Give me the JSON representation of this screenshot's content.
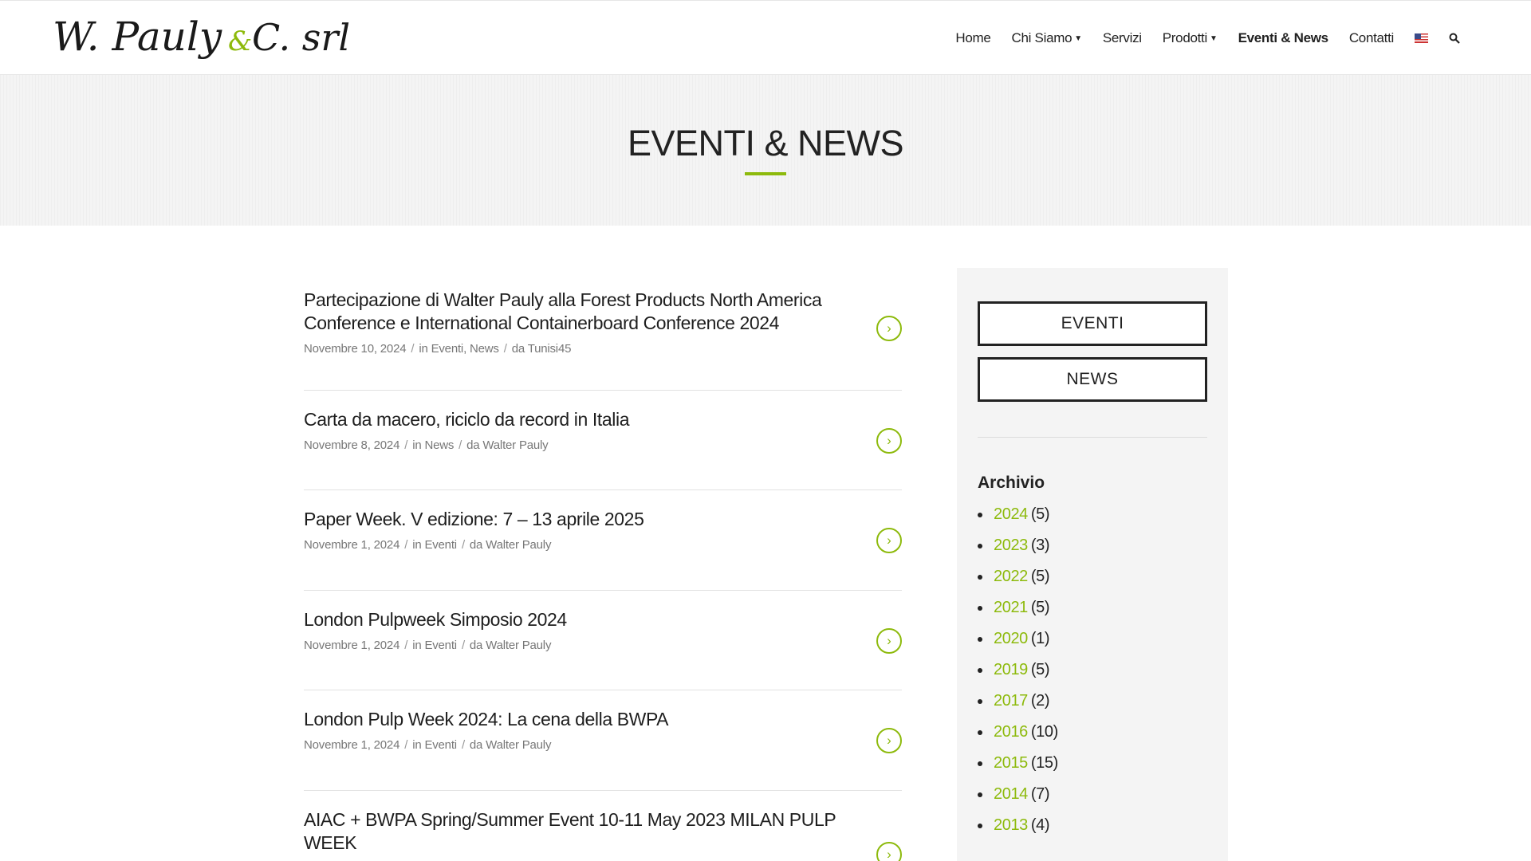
{
  "logo": {
    "text_main": "W. Pauly",
    "text_amp": "&",
    "text_tail": "C. srl"
  },
  "nav": {
    "items": [
      {
        "label": "Home",
        "dropdown": false,
        "active": false
      },
      {
        "label": "Chi Siamo",
        "dropdown": true,
        "active": false
      },
      {
        "label": "Servizi",
        "dropdown": false,
        "active": false
      },
      {
        "label": "Prodotti",
        "dropdown": true,
        "active": false
      },
      {
        "label": "Eventi & News",
        "dropdown": false,
        "active": true
      },
      {
        "label": "Contatti",
        "dropdown": false,
        "active": false
      }
    ],
    "flag_icon": "us-flag-icon",
    "search_icon": "search-icon"
  },
  "banner": {
    "title": "EVENTI & NEWS"
  },
  "posts": [
    {
      "title": "Partecipazione di Walter Pauly alla Forest Products North America Conference e International Containerboard Conference 2024",
      "date": "Novembre 10, 2024",
      "in_label": "in",
      "categories": "Eventi, News",
      "by_label": "da",
      "author": "Tunisi45"
    },
    {
      "title": "Carta da macero, riciclo da record in Italia",
      "date": "Novembre 8, 2024",
      "in_label": "in",
      "categories": "News",
      "by_label": "da",
      "author": "Walter Pauly"
    },
    {
      "title": "Paper Week. V edizione: 7 – 13 aprile 2025",
      "date": "Novembre 1, 2024",
      "in_label": "in",
      "categories": "Eventi",
      "by_label": "da",
      "author": "Walter Pauly"
    },
    {
      "title": "London Pulpweek Simposio 2024",
      "date": "Novembre 1, 2024",
      "in_label": "in",
      "categories": "Eventi",
      "by_label": "da",
      "author": "Walter Pauly"
    },
    {
      "title": "London Pulp Week 2024: La cena della BWPA",
      "date": "Novembre 1, 2024",
      "in_label": "in",
      "categories": "Eventi",
      "by_label": "da",
      "author": "Walter Pauly"
    },
    {
      "title": "AIAC + BWPA Spring/Summer Event 10-11 May 2023 MILAN PULP WEEK",
      "date": "",
      "in_label": "",
      "categories": "",
      "by_label": "",
      "author": ""
    }
  ],
  "sidebar": {
    "buttons": [
      "EVENTI",
      "NEWS"
    ],
    "archive_title": "Archivio",
    "archive": [
      {
        "year": "2024",
        "count": "(5)"
      },
      {
        "year": "2023",
        "count": "(3)"
      },
      {
        "year": "2022",
        "count": "(5)"
      },
      {
        "year": "2021",
        "count": "(5)"
      },
      {
        "year": "2020",
        "count": "(1)"
      },
      {
        "year": "2019",
        "count": "(5)"
      },
      {
        "year": "2017",
        "count": "(2)"
      },
      {
        "year": "2016",
        "count": "(10)"
      },
      {
        "year": "2015",
        "count": "(15)"
      },
      {
        "year": "2014",
        "count": "(7)"
      },
      {
        "year": "2013",
        "count": "(4)"
      }
    ]
  },
  "colors": {
    "accent": "#8dba0c",
    "text": "#222222",
    "banner_bg": "#f4f4f4",
    "sidebar_bg": "#f4f4f4"
  }
}
